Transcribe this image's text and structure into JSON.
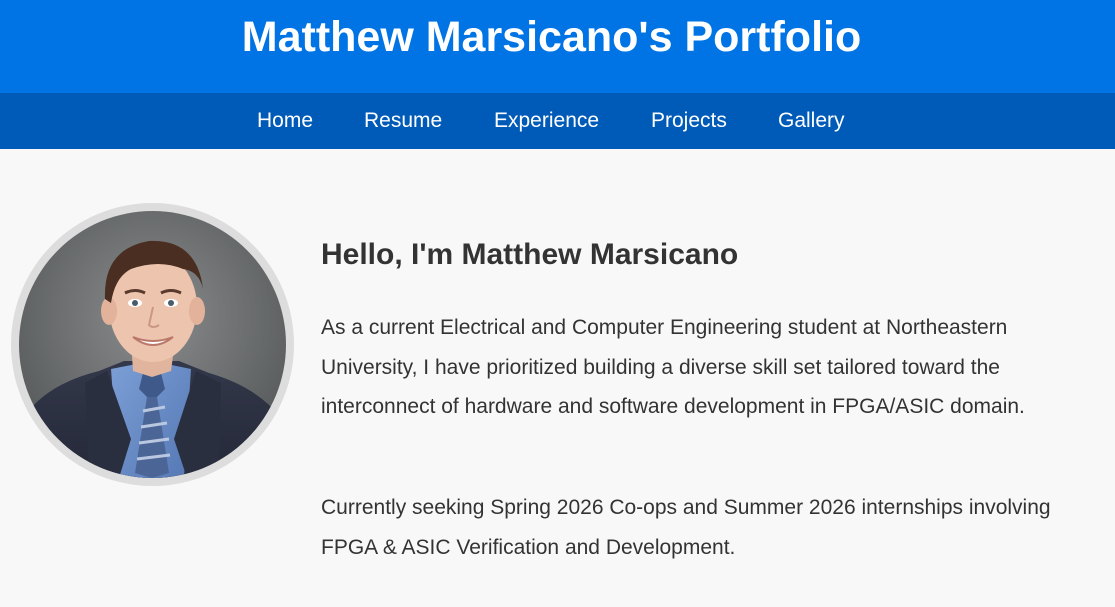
{
  "header": {
    "title": "Matthew Marsicano's Portfolio",
    "background_color": "#0074e4"
  },
  "nav": {
    "background_color": "#005bb8",
    "items": [
      {
        "label": "Home"
      },
      {
        "label": "Resume"
      },
      {
        "label": "Experience"
      },
      {
        "label": "Projects"
      },
      {
        "label": "Gallery"
      }
    ]
  },
  "profile": {
    "photo_icon": "profile-photo"
  },
  "about": {
    "greeting": "Hello, I'm Matthew Marsicano",
    "paragraph_1": "As a current Electrical and Computer Engineering student at Northeastern University, I have prioritized building a diverse skill set tailored toward the interconnect of hardware and software development in FPGA/ASIC domain.",
    "paragraph_2": "Currently seeking Spring 2026 Co-ops and Summer 2026 internships involving FPGA & ASIC Verification and Development."
  }
}
